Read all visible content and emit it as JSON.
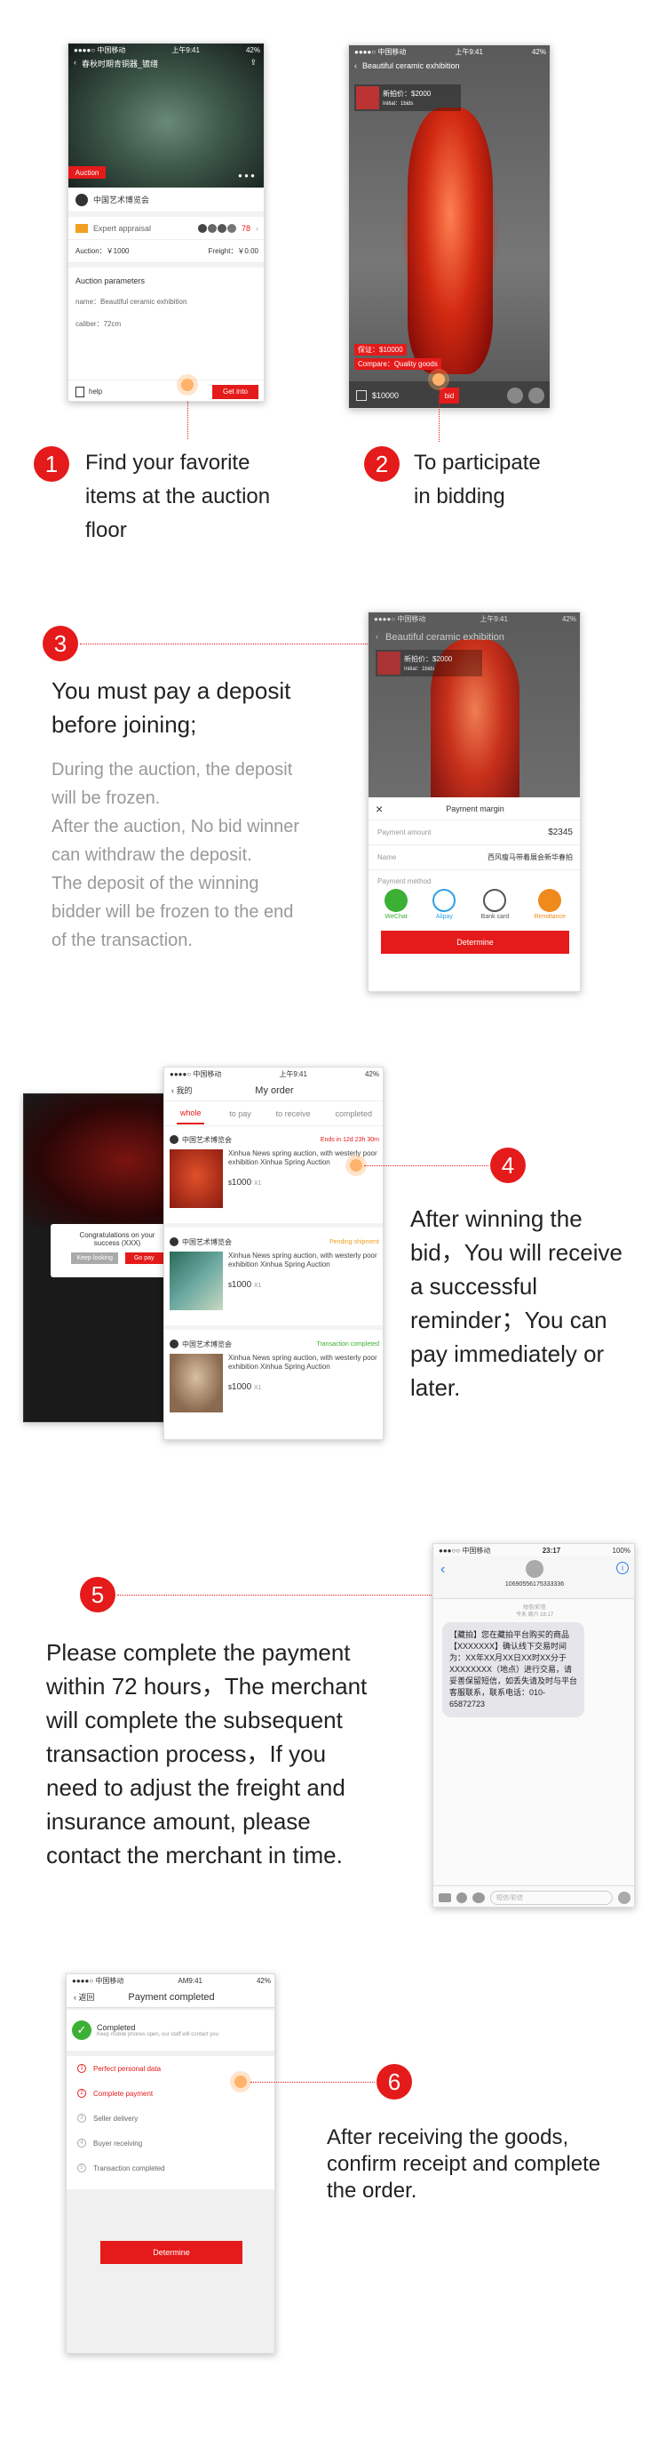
{
  "colors": {
    "accent": "#e51a1a",
    "dot": "#ffb36b"
  },
  "steps": [
    {
      "num": "1",
      "text_lines": [
        "Find your favorite",
        "items at the auction",
        "floor"
      ]
    },
    {
      "num": "2",
      "text_lines": [
        "To participate",
        "in bidding"
      ]
    },
    {
      "num": "3",
      "title_lines": [
        "You must pay a deposit",
        "before  joining;"
      ],
      "body_lines": [
        "During the auction, the deposit",
        "will be frozen.",
        "After the auction, No bid winner",
        "can withdraw the deposit.",
        "The deposit of the winning",
        "bidder will be frozen to the end",
        "of the transaction."
      ]
    },
    {
      "num": "4",
      "text_lines": [
        "After winning the",
        "bid，You will receive",
        "a successful",
        "reminder；You can",
        "pay immediately or",
        "later."
      ]
    },
    {
      "num": "5",
      "text_lines": [
        "Please complete the payment",
        "within 72 hours，The merchant",
        "will complete the subsequent",
        "transaction process，If you",
        "need to adjust the freight and",
        "insurance amount, please",
        "contact the merchant in time."
      ]
    },
    {
      "num": "6",
      "text_lines": [
        "After receiving the goods,",
        "confirm receipt and complete",
        "the order."
      ]
    }
  ],
  "phone1": {
    "status": {
      "carrier": "●●●●○ 中国移动",
      "time": "上午9:41",
      "battery": "42%"
    },
    "title": "春秋时期青铜器_镀缮",
    "badge": "Auction",
    "org": "中国艺术博览会",
    "appraisal_label": "Expert appraisal",
    "appraisal_count": "78",
    "auction_label": "Auction：￥1000",
    "freight_label": "Freight：￥0.00",
    "params_title": "Auction parameters",
    "param_name": "name：Beautiful ceramic exhibition",
    "param_caliber": "caliber：72cm",
    "help": "help",
    "get_into": "Get into"
  },
  "phone2": {
    "status": {
      "carrier": "●●●●○ 中国移动",
      "time": "上午9:41",
      "battery": "42%"
    },
    "title": "Beautiful ceramic exhibition",
    "bid_top": "新拍价：$2000",
    "bid_top_sub": "Initial：1bids",
    "deposit": "保证：$10000",
    "compare": "Compare：Quality goods",
    "price": "$10000",
    "bid": "bid"
  },
  "phone3": {
    "status": {
      "carrier": "●●●●○ 中国移动",
      "time": "上午9:41",
      "battery": "42%"
    },
    "title": "Beautiful ceramic exhibition",
    "bid_top": "新拍价：$2000",
    "bid_top_sub": "Initial：1bids",
    "sheet_title": "Payment margin",
    "amount_label": "Payment amount",
    "amount": "$2345",
    "name_label": "Name",
    "name_value": "西风瘦马带着展会新华春拍",
    "method_label": "Payment method",
    "methods": [
      {
        "label": "WeChat",
        "color": "#3cb034"
      },
      {
        "label": "Alipay",
        "color": "#2ea0e8"
      },
      {
        "label": "Bank card",
        "color": "#555"
      },
      {
        "label": "Remittance",
        "color": "#f08a1c"
      }
    ],
    "determine": "Determine"
  },
  "phone4bg": {
    "popup_line1": "Congratulations on your",
    "popup_line2": "success (XXX)",
    "keep": "Keep looking",
    "pay": "Go pay"
  },
  "phone4": {
    "status": {
      "carrier": "●●●●○ 中国移动",
      "time": "上午9:41",
      "battery": "42%"
    },
    "back": "我的",
    "title": "My order",
    "tabs": [
      "whole",
      "to pay",
      "to receive",
      "completed"
    ],
    "orders": [
      {
        "org": "中国艺术博览会",
        "status": "Ends in 12d 23h 30m",
        "status_color": "#e51a1a",
        "desc": "Xinhua News spring auction, with westerly poor exhibition Xinhua Spring Auction",
        "price": "1000",
        "qty": "X1",
        "img": "vase"
      },
      {
        "org": "中国艺术博览会",
        "status": "Pending shipment",
        "status_color": "#f0a020",
        "desc": "Xinhua News spring auction, with westerly poor exhibition Xinhua Spring Auction",
        "price": "1000",
        "qty": "X1",
        "img": "paint"
      },
      {
        "org": "中国艺术博览会",
        "status": "Transaction completed",
        "status_color": "#3cb034",
        "desc": "Xinhua News spring auction, with westerly poor exhibition Xinhua Spring Auction",
        "price": "1000",
        "qty": "X1",
        "img": "statue"
      }
    ]
  },
  "phone5": {
    "status": {
      "carrier": "●●●○○ 中国移动",
      "time": "23:17",
      "battery": "100%"
    },
    "sender": "10690556175333336",
    "meta": "短信/彩信",
    "meta2": "今天 周六 18:17",
    "sms": "【藏拍】您在藏拍平台购买的商品【XXXXXXX】确认线下交易时间为：XX年XX月XX日XX时XX分于XXXXXXXX（地点）进行交易，请妥善保留短信，如丢失请及时与平台客服联系，联系电话：010-65872723",
    "placeholder": "短信/彩信"
  },
  "phone6": {
    "status": {
      "carrier": "●●●●○ 中国移动",
      "time": "AM9:41",
      "battery": "42%"
    },
    "back": "返回",
    "title": "Payment completed",
    "done": "Completed",
    "done_sub": "Keep mobile phones open, our staff will contact you",
    "steps": [
      {
        "n": "1",
        "label": "Perfect personal data",
        "active": true
      },
      {
        "n": "2",
        "label": "Complete payment",
        "active": true
      },
      {
        "n": "3",
        "label": "Seller delivery",
        "active": false
      },
      {
        "n": "4",
        "label": "Buyer receiving",
        "active": false
      },
      {
        "n": "5",
        "label": "Transaction completed",
        "active": false
      }
    ],
    "determine": "Determine"
  }
}
